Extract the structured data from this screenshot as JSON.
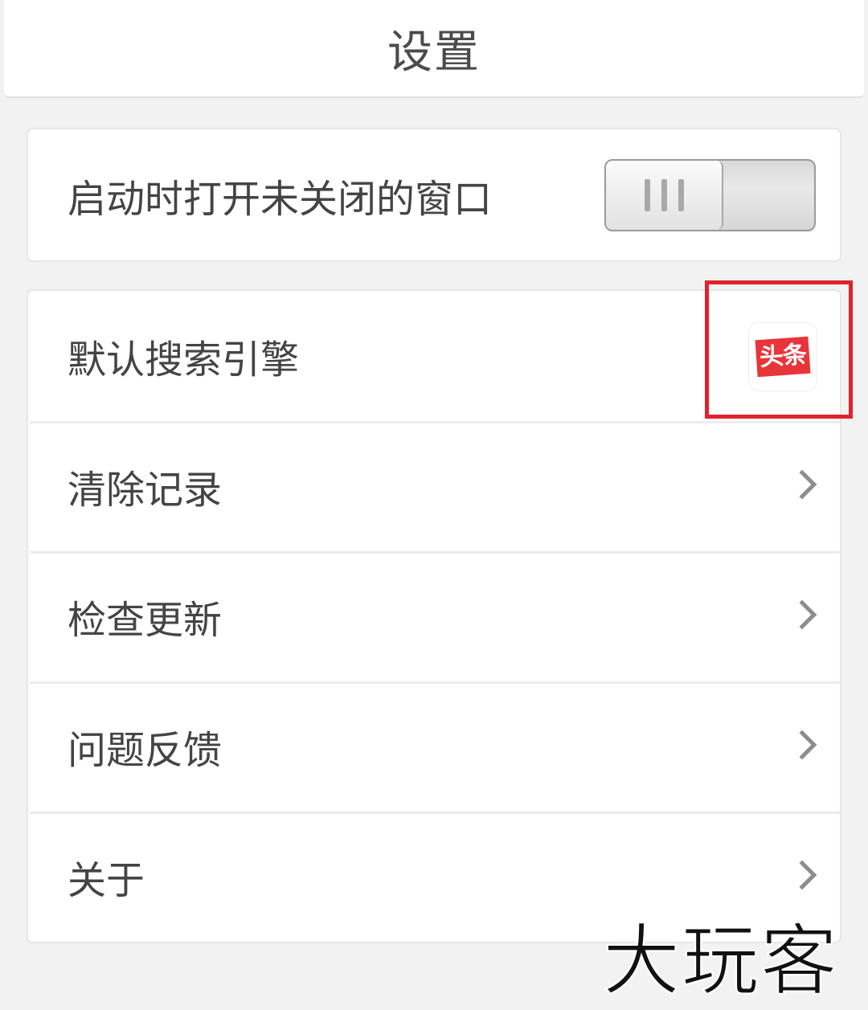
{
  "header": {
    "title": "设置"
  },
  "startup": {
    "label": "启动时打开未关闭的窗口",
    "toggle_on": false
  },
  "settings_list": [
    {
      "label": "默认搜索引擎",
      "trailing": "engine-logo",
      "engine_logo_text": "头条"
    },
    {
      "label": "清除记录",
      "trailing": "chevron-right-icon"
    },
    {
      "label": "检查更新",
      "trailing": "chevron-right-icon"
    },
    {
      "label": "问题反馈",
      "trailing": "chevron-right-icon"
    },
    {
      "label": "关于",
      "trailing": "chevron-right-icon"
    }
  ],
  "colors": {
    "background": "#f2f2f2",
    "card": "#ffffff",
    "highlight": "#e0222b",
    "engine_logo_red": "#e8353a"
  },
  "watermark": {
    "text": "大玩客"
  }
}
